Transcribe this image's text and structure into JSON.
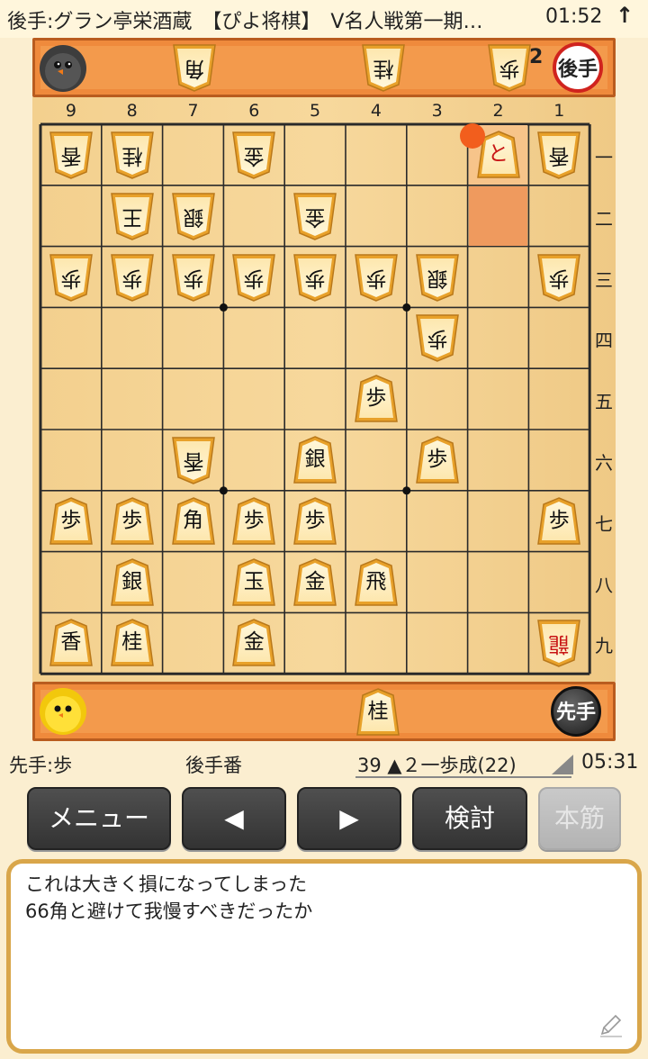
{
  "header": {
    "title": "後手:グラン亭栄酒蔵　【ぴよ将棋】　V名人戦第一期…",
    "time": "01:52",
    "menu_icon": "up-arrow-icon"
  },
  "gote": {
    "avatar": "black-chick-avatar",
    "badge": "後手",
    "hand": [
      {
        "kanji": "角",
        "count": ""
      },
      {
        "kanji": "桂",
        "count": ""
      },
      {
        "kanji": "歩",
        "count": "2"
      }
    ]
  },
  "sente": {
    "avatar": "yellow-chick-avatar",
    "badge": "先手",
    "hand": [
      {
        "kanji": "桂",
        "count": ""
      }
    ]
  },
  "board": {
    "files": [
      "9",
      "8",
      "7",
      "6",
      "5",
      "4",
      "3",
      "2",
      "1"
    ],
    "ranks": [
      "一",
      "二",
      "三",
      "四",
      "五",
      "六",
      "七",
      "八",
      "九"
    ],
    "pieces": [
      {
        "f": 9,
        "r": 1,
        "k": "香",
        "o": "g"
      },
      {
        "f": 8,
        "r": 1,
        "k": "桂",
        "o": "g"
      },
      {
        "f": 6,
        "r": 1,
        "k": "金",
        "o": "g"
      },
      {
        "f": 2,
        "r": 1,
        "k": "と",
        "o": "s",
        "red": true
      },
      {
        "f": 1,
        "r": 1,
        "k": "香",
        "o": "g"
      },
      {
        "f": 8,
        "r": 2,
        "k": "王",
        "o": "g"
      },
      {
        "f": 7,
        "r": 2,
        "k": "銀",
        "o": "g"
      },
      {
        "f": 5,
        "r": 2,
        "k": "金",
        "o": "g"
      },
      {
        "f": 9,
        "r": 3,
        "k": "歩",
        "o": "g"
      },
      {
        "f": 8,
        "r": 3,
        "k": "歩",
        "o": "g"
      },
      {
        "f": 7,
        "r": 3,
        "k": "歩",
        "o": "g"
      },
      {
        "f": 6,
        "r": 3,
        "k": "歩",
        "o": "g"
      },
      {
        "f": 5,
        "r": 3,
        "k": "歩",
        "o": "g"
      },
      {
        "f": 4,
        "r": 3,
        "k": "歩",
        "o": "g"
      },
      {
        "f": 3,
        "r": 3,
        "k": "銀",
        "o": "g"
      },
      {
        "f": 1,
        "r": 3,
        "k": "歩",
        "o": "g"
      },
      {
        "f": 3,
        "r": 4,
        "k": "歩",
        "o": "g"
      },
      {
        "f": 4,
        "r": 5,
        "k": "歩",
        "o": "s"
      },
      {
        "f": 7,
        "r": 6,
        "k": "香",
        "o": "g"
      },
      {
        "f": 5,
        "r": 6,
        "k": "銀",
        "o": "s"
      },
      {
        "f": 3,
        "r": 6,
        "k": "歩",
        "o": "s"
      },
      {
        "f": 9,
        "r": 7,
        "k": "歩",
        "o": "s"
      },
      {
        "f": 8,
        "r": 7,
        "k": "歩",
        "o": "s"
      },
      {
        "f": 7,
        "r": 7,
        "k": "角",
        "o": "s"
      },
      {
        "f": 6,
        "r": 7,
        "k": "歩",
        "o": "s"
      },
      {
        "f": 5,
        "r": 7,
        "k": "歩",
        "o": "s"
      },
      {
        "f": 1,
        "r": 7,
        "k": "歩",
        "o": "s"
      },
      {
        "f": 8,
        "r": 8,
        "k": "銀",
        "o": "s"
      },
      {
        "f": 6,
        "r": 8,
        "k": "玉",
        "o": "s"
      },
      {
        "f": 5,
        "r": 8,
        "k": "金",
        "o": "s"
      },
      {
        "f": 4,
        "r": 8,
        "k": "飛",
        "o": "s"
      },
      {
        "f": 9,
        "r": 9,
        "k": "香",
        "o": "s"
      },
      {
        "f": 8,
        "r": 9,
        "k": "桂",
        "o": "s"
      },
      {
        "f": 6,
        "r": 9,
        "k": "金",
        "o": "s"
      },
      {
        "f": 1,
        "r": 9,
        "k": "龍",
        "o": "g",
        "red": true
      }
    ],
    "last_move_from": {
      "f": 2,
      "r": 2
    },
    "last_move_to": {
      "f": 2,
      "r": 1
    }
  },
  "status": {
    "hand_label": "先手:歩",
    "turn": "後手番",
    "move": "39 ▲２一歩成(22)",
    "time": "05:31"
  },
  "buttons": {
    "menu": "メニュー",
    "prev": "◀",
    "next": "▶",
    "analyze": "検討",
    "mainline": "本筋"
  },
  "comment": {
    "text": "これは大きく損になってしまった\n66角と避けて我慢すべきだったか",
    "edit_icon": "pencil-icon"
  }
}
